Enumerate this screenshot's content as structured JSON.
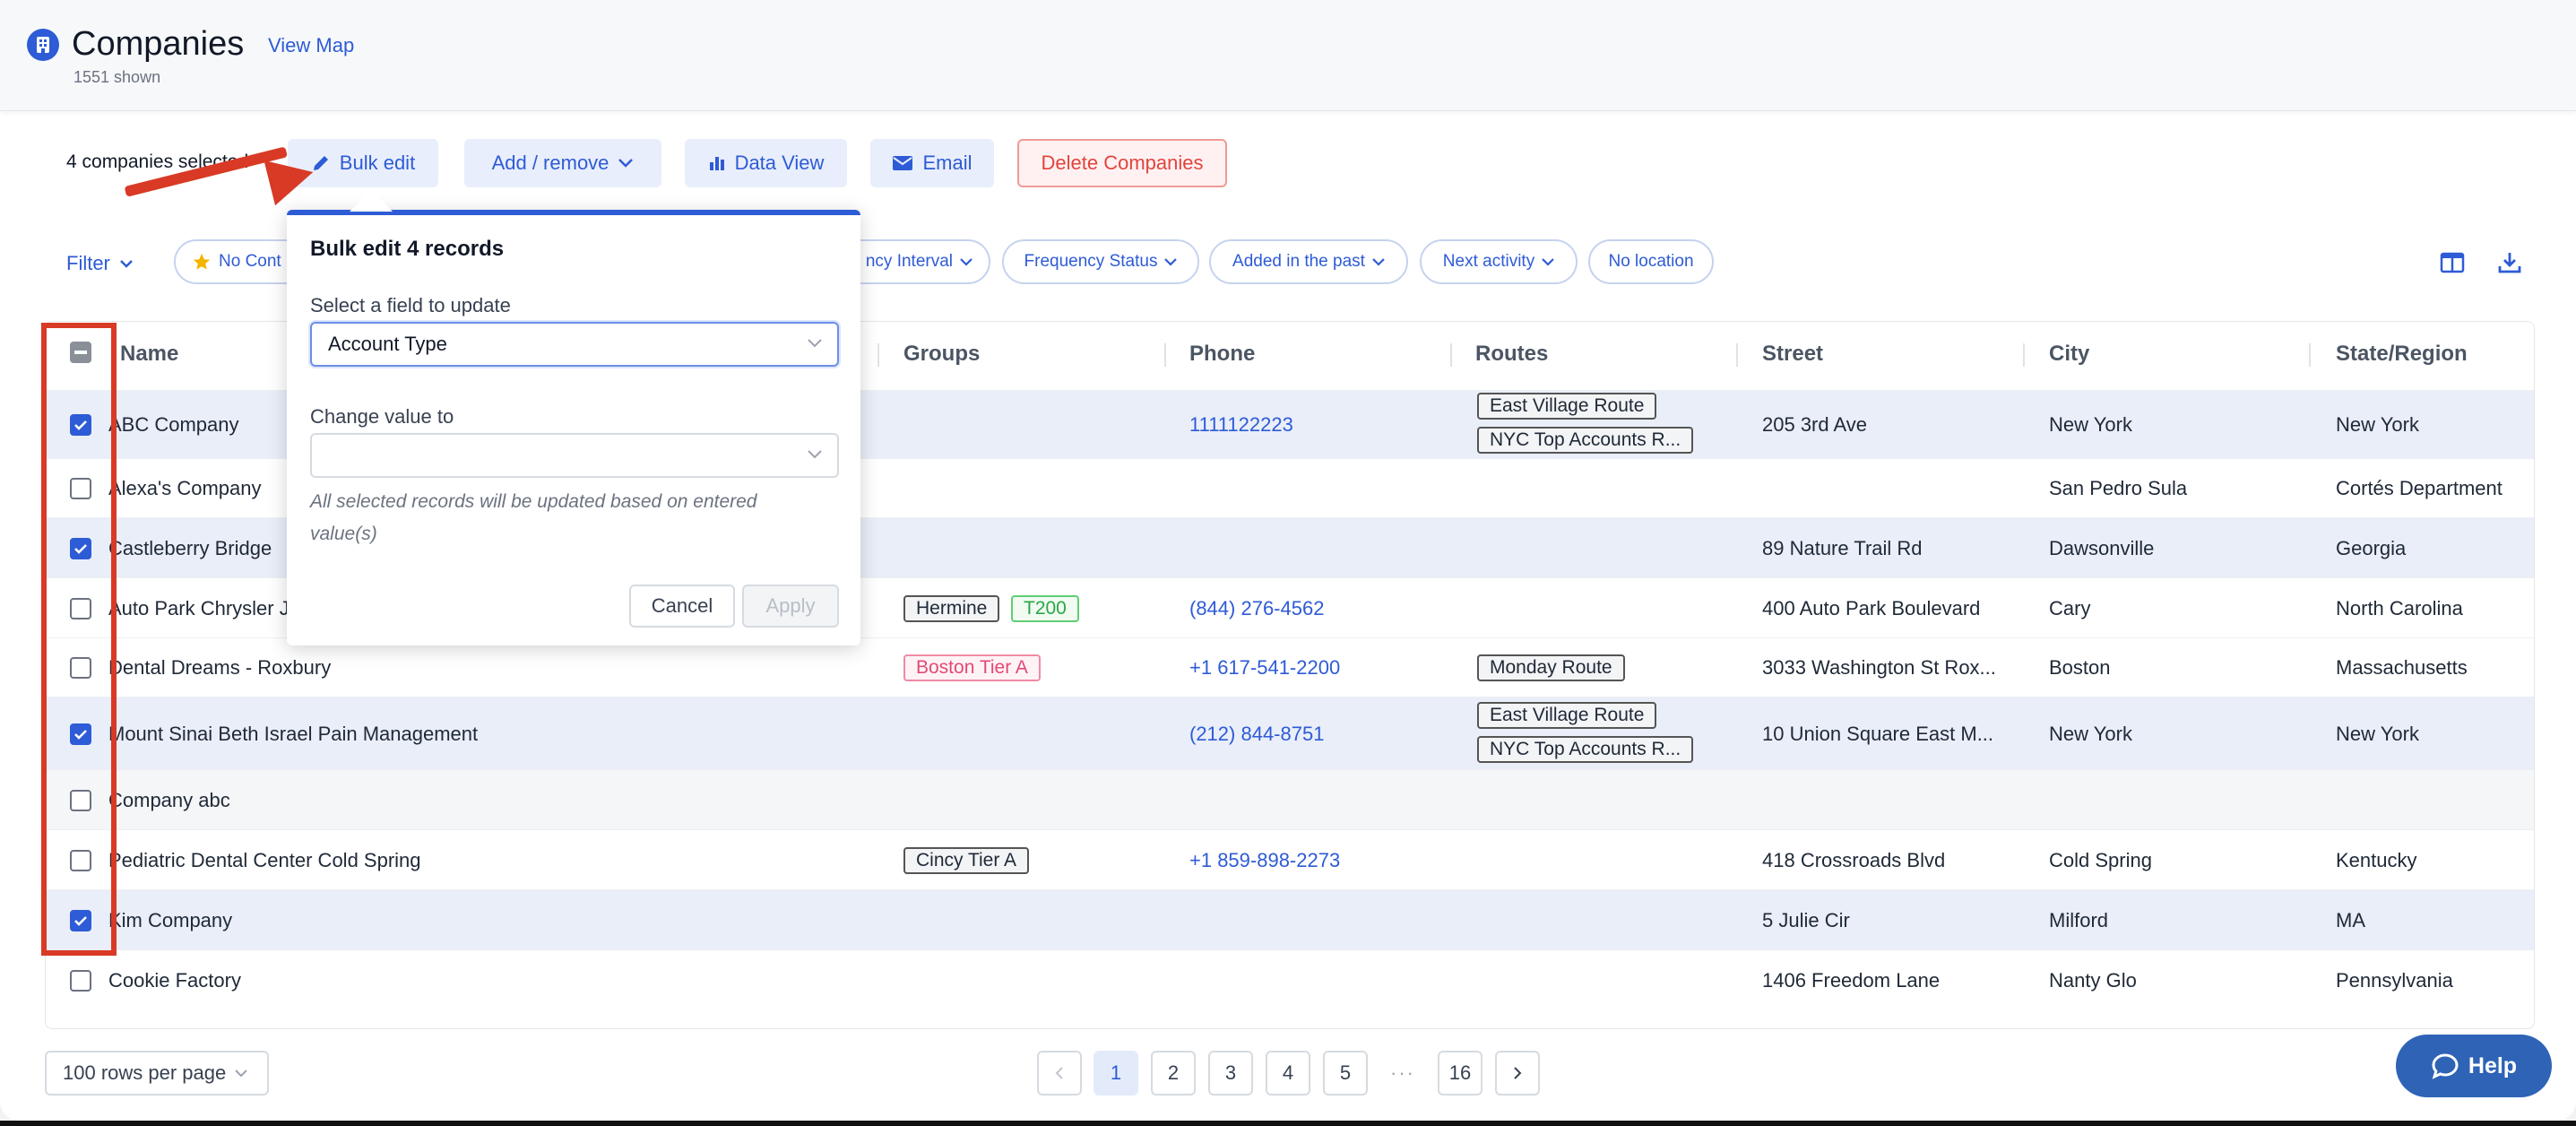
{
  "header": {
    "title": "Companies",
    "view_map": "View Map",
    "shown": "1551 shown"
  },
  "toolbar": {
    "selected": "4 companies selected",
    "bulk_edit": "Bulk edit",
    "add_remove": "Add / remove",
    "data_view": "Data View",
    "email": "Email",
    "delete": "Delete Companies"
  },
  "filters": {
    "filter_label": "Filter",
    "pills": [
      "No Cont",
      "ncy Interval",
      "Frequency Status",
      "Added in the past",
      "Next activity",
      "No location"
    ]
  },
  "table": {
    "columns": [
      "Name",
      "Groups",
      "Phone",
      "Routes",
      "Street",
      "City",
      "State/Region"
    ],
    "rows": [
      {
        "name": "ABC Company",
        "checked": true,
        "groups": [],
        "phone": "1111122223",
        "routes": [
          "East Village Route",
          "NYC Top Accounts R..."
        ],
        "street": "205 3rd Ave",
        "city": "New York",
        "state": "New York"
      },
      {
        "name": "Alexa's Company",
        "checked": false,
        "groups": [],
        "phone": "",
        "routes": [],
        "street": "",
        "city": "San Pedro Sula",
        "state": "Cortés Department"
      },
      {
        "name": "Castleberry Bridge",
        "checked": true,
        "groups": [],
        "phone": "",
        "routes": [],
        "street": "89 Nature Trail Rd",
        "city": "Dawsonville",
        "state": "Georgia"
      },
      {
        "name": "Auto Park Chrysler J",
        "checked": false,
        "groups": [
          "Hermine",
          "T200"
        ],
        "phone": "(844) 276-4562",
        "routes": [],
        "street": "400 Auto Park Boulevard",
        "city": "Cary",
        "state": "North Carolina"
      },
      {
        "name": "Dental Dreams - Roxbury",
        "checked": false,
        "groups": [
          "Boston Tier A"
        ],
        "phone": "+1 617-541-2200",
        "routes": [
          "Monday Route"
        ],
        "street": "3033 Washington St Rox...",
        "city": "Boston",
        "state": "Massachusetts"
      },
      {
        "name": "Mount Sinai Beth Israel Pain Management",
        "checked": true,
        "groups": [],
        "phone": "(212) 844-8751",
        "routes": [
          "East Village Route",
          "NYC Top Accounts R..."
        ],
        "street": "10 Union Square East M...",
        "city": "New York",
        "state": "New York"
      },
      {
        "name": "Company abc",
        "checked": false,
        "groups": [],
        "phone": "",
        "routes": [],
        "street": "",
        "city": "",
        "state": ""
      },
      {
        "name": "Pediatric Dental Center Cold Spring",
        "checked": false,
        "groups": [
          "Cincy Tier A"
        ],
        "phone": "+1 859-898-2273",
        "routes": [],
        "street": "418 Crossroads Blvd",
        "city": "Cold Spring",
        "state": "Kentucky"
      },
      {
        "name": "Kim Company",
        "checked": true,
        "groups": [],
        "phone": "",
        "routes": [],
        "street": "5 Julie Cir",
        "city": "Milford",
        "state": "MA"
      },
      {
        "name": "Cookie Factory",
        "checked": false,
        "groups": [],
        "phone": "",
        "routes": [],
        "street": "1406 Freedom Lane",
        "city": "Nanty Glo",
        "state": "Pennsylvania"
      }
    ]
  },
  "popover": {
    "title": "Bulk edit 4 records",
    "field_label": "Select a field to update",
    "field_value": "Account Type",
    "change_label": "Change value to",
    "change_value": "",
    "hint": "All selected records will be updated based on entered value(s)",
    "cancel": "Cancel",
    "apply": "Apply"
  },
  "footer": {
    "rows_per_page": "100 rows per page",
    "pages": [
      "1",
      "2",
      "3",
      "4",
      "5",
      "···",
      "16"
    ],
    "current_page": "1",
    "help": "Help"
  },
  "colors": {
    "accent": "#2e5bd6",
    "danger": "#e2443c",
    "annotation": "#d83a26"
  }
}
